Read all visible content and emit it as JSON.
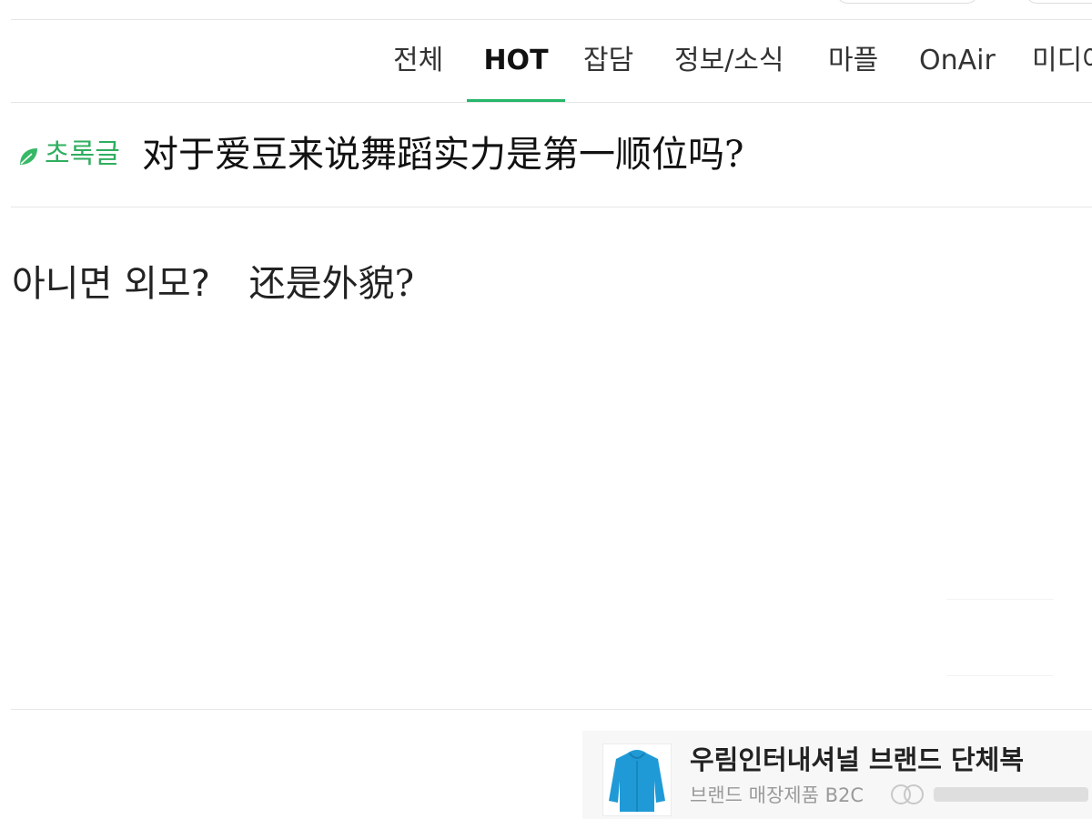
{
  "nav": {
    "tabs": [
      {
        "label": "전체",
        "active": false
      },
      {
        "label": "HOT",
        "active": true
      },
      {
        "label": "잡담",
        "active": false
      },
      {
        "label": "정보/소식",
        "active": false
      },
      {
        "label": "마플",
        "active": false
      },
      {
        "label": "OnAir",
        "active": false
      },
      {
        "label": "미디어",
        "active": false
      }
    ]
  },
  "post": {
    "category": "초록글",
    "title": "对于爱豆来说舞蹈实力是第一顺位吗?",
    "body_korean": "아니면 외모?",
    "body_chinese": "还是外貌?"
  },
  "ad": {
    "title": "우림인터내셔널 브랜드 단체복",
    "subtitle": "브랜드 매장제품 B2C",
    "icon": "jacket-icon"
  },
  "colors": {
    "accent": "#25b66a",
    "category_green": "#2fae5f",
    "divider": "#e6e6e6",
    "ad_background": "#f7f7f7",
    "jacket_blue": "#1f9ad6"
  }
}
